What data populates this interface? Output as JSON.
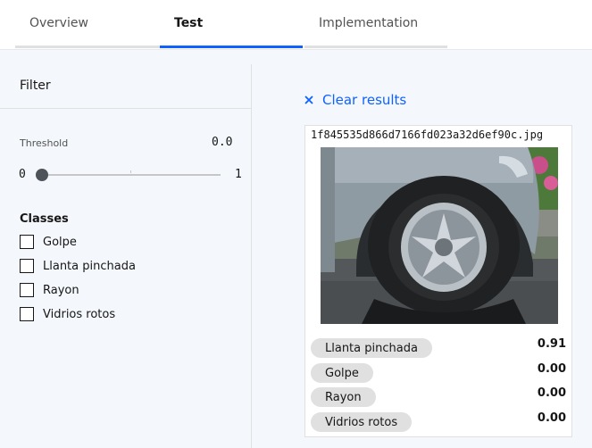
{
  "tabs": [
    {
      "label": "Overview"
    },
    {
      "label": "Test"
    },
    {
      "label": "Implementation"
    }
  ],
  "filter": {
    "title": "Filter",
    "threshold_label": "Threshold",
    "threshold_value": "0.0",
    "slider_min": "0",
    "slider_max": "1",
    "slider_level": 0.0,
    "classes_title": "Classes",
    "classes": [
      {
        "label": "Golpe",
        "checked": false
      },
      {
        "label": "Llanta pinchada",
        "checked": false
      },
      {
        "label": "Rayon",
        "checked": false
      },
      {
        "label": "Vidrios rotos",
        "checked": false
      }
    ]
  },
  "results": {
    "clear_label": "Clear results",
    "filename": "1f845535d866d7166fd023a32d6ef90c.jpg",
    "predictions": [
      {
        "label": "Llanta pinchada",
        "score": "0.91"
      },
      {
        "label": "Golpe",
        "score": "0.00"
      },
      {
        "label": "Rayon",
        "score": "0.00"
      },
      {
        "label": "Vidrios rotos",
        "score": "0.00"
      }
    ]
  },
  "colors": {
    "accent": "#0f62fe",
    "background": "#f4f7fb",
    "tag": "#e0e0e0"
  }
}
